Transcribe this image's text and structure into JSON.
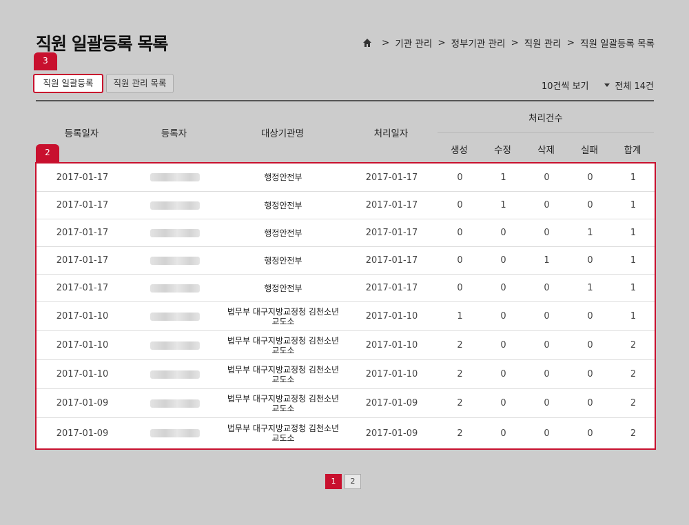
{
  "page": {
    "title": "직원 일괄등록 목록"
  },
  "breadcrumb": [
    "기관 관리",
    "정부기관 관리",
    "직원 관리",
    "직원 일괄등록 목록"
  ],
  "markers": {
    "buttons": "3",
    "table": "2"
  },
  "toolbar": {
    "bulk_label": "직원 일괄등록",
    "list_label": "직원 관리 목록",
    "per_page": "10건씩 보기",
    "total": "전체 14건"
  },
  "table": {
    "headers": {
      "date": "등록일자",
      "registrant": "등록자",
      "org": "대상기관명",
      "processed": "처리일자",
      "group": "처리건수",
      "create": "생성",
      "edit": "수정",
      "delete": "삭제",
      "fail": "실패",
      "sum": "합계"
    },
    "rows": [
      {
        "date": "2017-01-17",
        "org": "행정안전부",
        "processed": "2017-01-17",
        "create": "0",
        "edit": "1",
        "delete": "0",
        "fail": "0",
        "sum": "1"
      },
      {
        "date": "2017-01-17",
        "org": "행정안전부",
        "processed": "2017-01-17",
        "create": "0",
        "edit": "1",
        "delete": "0",
        "fail": "0",
        "sum": "1"
      },
      {
        "date": "2017-01-17",
        "org": "행정안전부",
        "processed": "2017-01-17",
        "create": "0",
        "edit": "0",
        "delete": "0",
        "fail": "1",
        "sum": "1"
      },
      {
        "date": "2017-01-17",
        "org": "행정안전부",
        "processed": "2017-01-17",
        "create": "0",
        "edit": "0",
        "delete": "1",
        "fail": "0",
        "sum": "1"
      },
      {
        "date": "2017-01-17",
        "org": "행정안전부",
        "processed": "2017-01-17",
        "create": "0",
        "edit": "0",
        "delete": "0",
        "fail": "1",
        "sum": "1"
      },
      {
        "date": "2017-01-10",
        "org": "법무부 대구지방교정청 김천소년교도소",
        "processed": "2017-01-10",
        "create": "1",
        "edit": "0",
        "delete": "0",
        "fail": "0",
        "sum": "1"
      },
      {
        "date": "2017-01-10",
        "org": "법무부 대구지방교정청 김천소년교도소",
        "processed": "2017-01-10",
        "create": "2",
        "edit": "0",
        "delete": "0",
        "fail": "0",
        "sum": "2"
      },
      {
        "date": "2017-01-10",
        "org": "법무부 대구지방교정청 김천소년교도소",
        "processed": "2017-01-10",
        "create": "2",
        "edit": "0",
        "delete": "0",
        "fail": "0",
        "sum": "2"
      },
      {
        "date": "2017-01-09",
        "org": "법무부 대구지방교정청 김천소년교도소",
        "processed": "2017-01-09",
        "create": "2",
        "edit": "0",
        "delete": "0",
        "fail": "0",
        "sum": "2"
      },
      {
        "date": "2017-01-09",
        "org": "법무부 대구지방교정청 김천소년교도소",
        "processed": "2017-01-09",
        "create": "2",
        "edit": "0",
        "delete": "0",
        "fail": "0",
        "sum": "2"
      }
    ]
  },
  "pagination": {
    "pages": [
      "1",
      "2"
    ],
    "current": "1"
  },
  "colors": {
    "accent": "#c8102e",
    "background": "#cccccc"
  }
}
